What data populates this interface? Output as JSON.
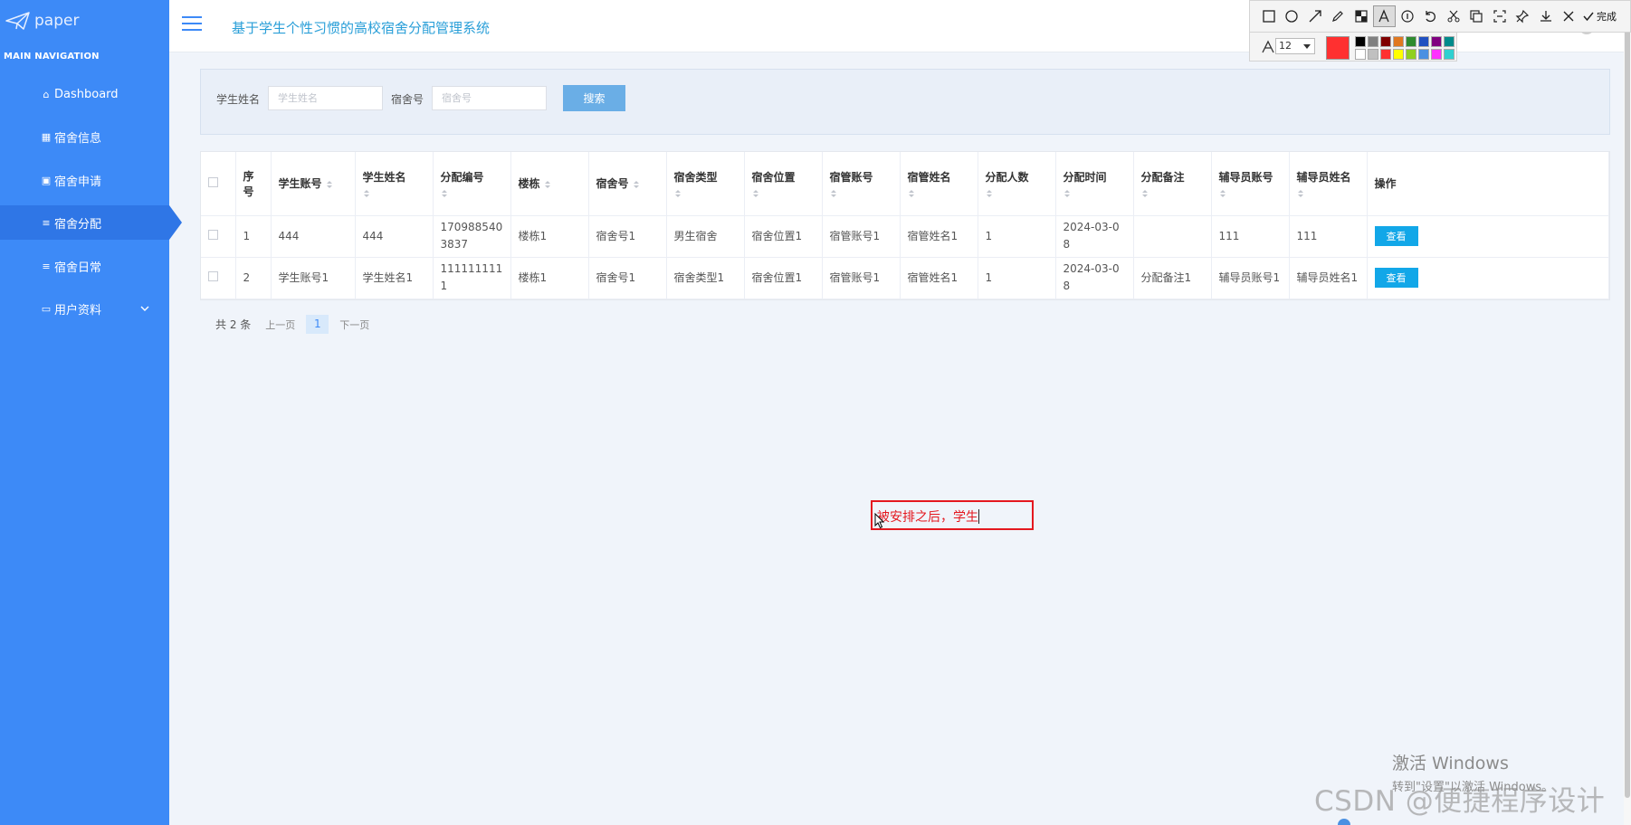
{
  "sidebar": {
    "logo_text": "paper",
    "heading": "MAIN NAVIGATION",
    "items": [
      {
        "label": "Dashboard",
        "icon": "home-icon"
      },
      {
        "label": "宿舍信息",
        "icon": "grid-icon"
      },
      {
        "label": "宿舍申请",
        "icon": "clipboard-icon"
      },
      {
        "label": "宿舍分配",
        "icon": "list-icon",
        "active": true
      },
      {
        "label": "宿舍日常",
        "icon": "list-icon"
      },
      {
        "label": "用户资料",
        "icon": "card-icon",
        "expandable": true
      }
    ]
  },
  "header": {
    "title": "基于学生个性习惯的高校宿舍分配管理系统",
    "menu_icon": "hamburger-icon"
  },
  "search": {
    "student_name_label": "学生姓名",
    "student_name_placeholder": "学生姓名",
    "dorm_no_label": "宿舍号",
    "dorm_no_placeholder": "宿舍号",
    "button_label": "搜索"
  },
  "table": {
    "columns": [
      "序号",
      "学生账号",
      "学生姓名",
      "分配编号",
      "楼栋",
      "宿舍号",
      "宿舍类型",
      "宿舍位置",
      "宿管账号",
      "宿管姓名",
      "分配人数",
      "分配时间",
      "分配备注",
      "辅导员账号",
      "辅导员姓名",
      "操作"
    ],
    "rows": [
      {
        "cells": [
          "1",
          "444",
          "444",
          "1709885403837",
          "楼栋1",
          "宿舍号1",
          "男生宿舍",
          "宿舍位置1",
          "宿管账号1",
          "宿管姓名1",
          "1",
          "2024-03-08",
          "",
          "111",
          "111"
        ],
        "action": "查看"
      },
      {
        "cells": [
          "2",
          "学生账号1",
          "学生姓名1",
          "1111111111",
          "楼栋1",
          "宿舍号1",
          "宿舍类型1",
          "宿舍位置1",
          "宿管账号1",
          "宿管姓名1",
          "1",
          "2024-03-08",
          "分配备注1",
          "辅导员账号1",
          "辅导员姓名1"
        ],
        "action": "查看"
      }
    ]
  },
  "pagination": {
    "total": "共 2 条",
    "prev": "上一页",
    "current": "1",
    "next": "下一页"
  },
  "annotation": {
    "text": "被安排之后，学生",
    "color": "#e4181f"
  },
  "snip_toolbar": {
    "tools": [
      "rectangle-icon",
      "ellipse-icon",
      "arrow-icon",
      "pen-icon",
      "mosaic-icon",
      "text-icon",
      "number-icon",
      "undo-icon",
      "cut-icon",
      "copy-icon",
      "ocr-icon",
      "pin-icon",
      "download-icon",
      "close-icon"
    ],
    "finish_label": "完成",
    "font_size": "12",
    "current_color": "#ff3030",
    "palette": [
      "#000000",
      "#808080",
      "#800000",
      "#e07820",
      "#2e8b2e",
      "#2050c0",
      "#800080",
      "#008b8b",
      "#ffffff",
      "#c0c0c0",
      "#ff3030",
      "#ffff00",
      "#90d020",
      "#4a90e2",
      "#ff30ff",
      "#30d0d0"
    ]
  },
  "watermarks": {
    "activate_line1": "激活 Windows",
    "activate_line2": "转到\"设置\"以激活 Windows。",
    "csdn": "CSDN @便捷程序设计"
  },
  "colors": {
    "sidebar": "#3d8af7",
    "sidebar_active": "#2f76e6",
    "title": "#2a9fd8",
    "action_button": "#12a7e8"
  }
}
